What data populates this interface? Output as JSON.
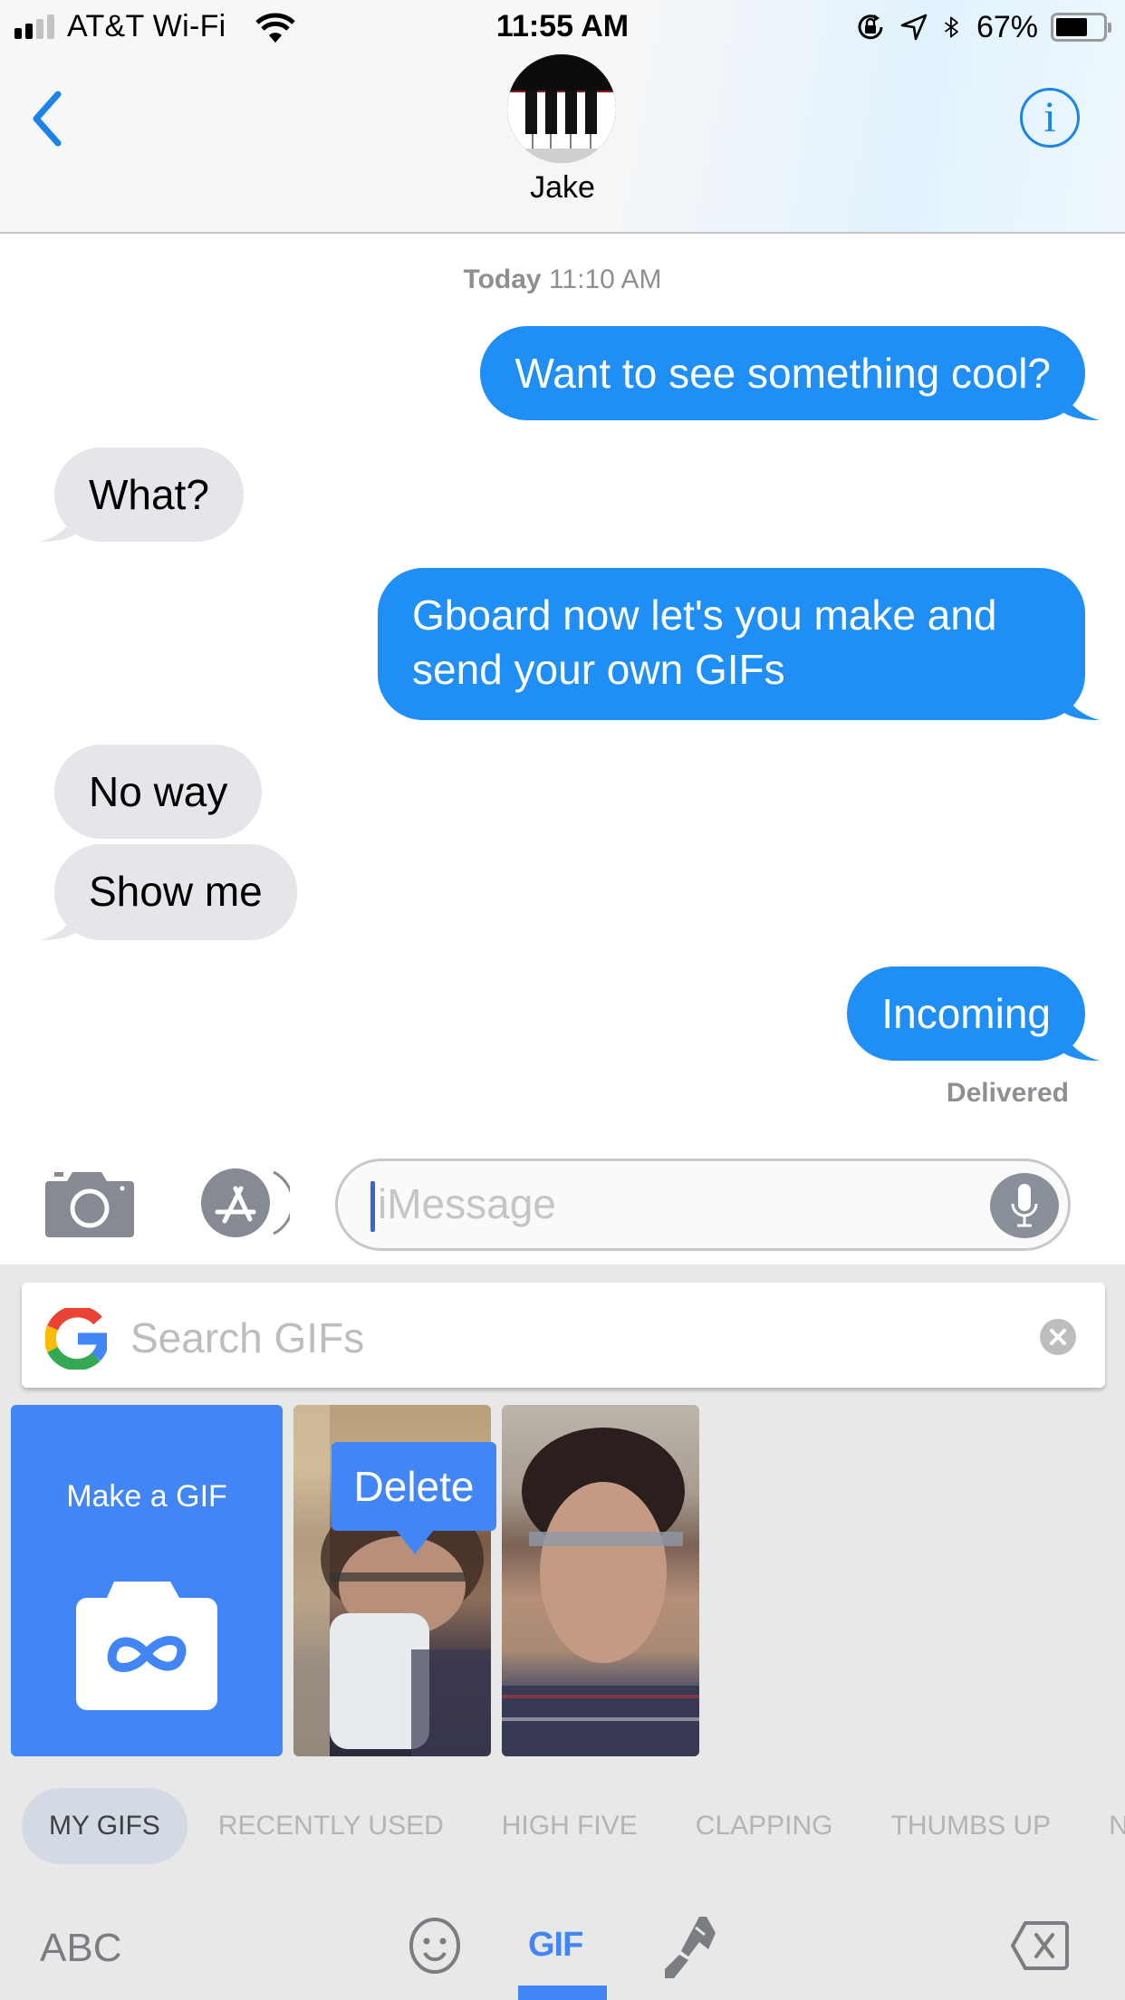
{
  "status_bar": {
    "carrier": "AT&T Wi-Fi",
    "signal_bars_active": 2,
    "signal_bars_total": 4,
    "time": "11:55 AM",
    "battery_percent_label": "67%",
    "battery_level": 0.67,
    "icons": [
      "orientation-lock-icon",
      "location-icon",
      "bluetooth-icon"
    ]
  },
  "nav": {
    "back_icon": "chevron-left-icon",
    "contact_name": "Jake",
    "avatar": "piano-keys-avatar",
    "info_icon": "info-icon"
  },
  "conversation": {
    "timestamp_day": "Today",
    "timestamp_time": "11:10 AM",
    "messages": [
      {
        "direction": "outgoing",
        "text": "Want to see something cool?"
      },
      {
        "direction": "incoming",
        "text": "What?"
      },
      {
        "direction": "outgoing",
        "text": "Gboard now let's you make and send your own GIFs"
      },
      {
        "direction": "incoming",
        "text": "No way"
      },
      {
        "direction": "incoming",
        "text": "Show me"
      },
      {
        "direction": "outgoing",
        "text": "Incoming"
      }
    ],
    "delivery_status": "Delivered"
  },
  "input_bar": {
    "camera_icon": "camera-icon",
    "apps_icon": "app-store-icon",
    "message_placeholder": "iMessage",
    "mic_icon": "microphone-icon"
  },
  "keyboard": {
    "search_placeholder": "Search GIFs",
    "search_logo": "google-g-icon",
    "clear_icon": "clear-icon",
    "make_gif_label": "Make a GIF",
    "make_gif_icon": "camera-infinity-icon",
    "gifs": [
      {
        "name": "gif-drinking-mug"
      },
      {
        "name": "gif-adjusting-glasses"
      }
    ],
    "tooltip_label": "Delete",
    "categories": [
      {
        "label": "MY GIFS",
        "active": true
      },
      {
        "label": "RECENTLY USED",
        "active": false
      },
      {
        "label": "HIGH FIVE",
        "active": false
      },
      {
        "label": "CLAPPING",
        "active": false
      },
      {
        "label": "THUMBS UP",
        "active": false
      },
      {
        "label": "N",
        "active": false
      }
    ],
    "bottom_bar": {
      "abc_label": "ABC",
      "emoji_icon": "smiley-icon",
      "gif_label": "GIF",
      "sticker_icon": "sticker-pen-icon",
      "backspace_icon": "backspace-icon",
      "active_tab": "GIF"
    }
  },
  "colors": {
    "ios_blue": "#1b84e6",
    "outgoing_bubble": "#1f8ff5",
    "incoming_bubble": "#e5e5ea",
    "google_blue": "#4285f4",
    "keyboard_bg": "#e8e8e8",
    "secondary_text": "#8e8e93"
  }
}
